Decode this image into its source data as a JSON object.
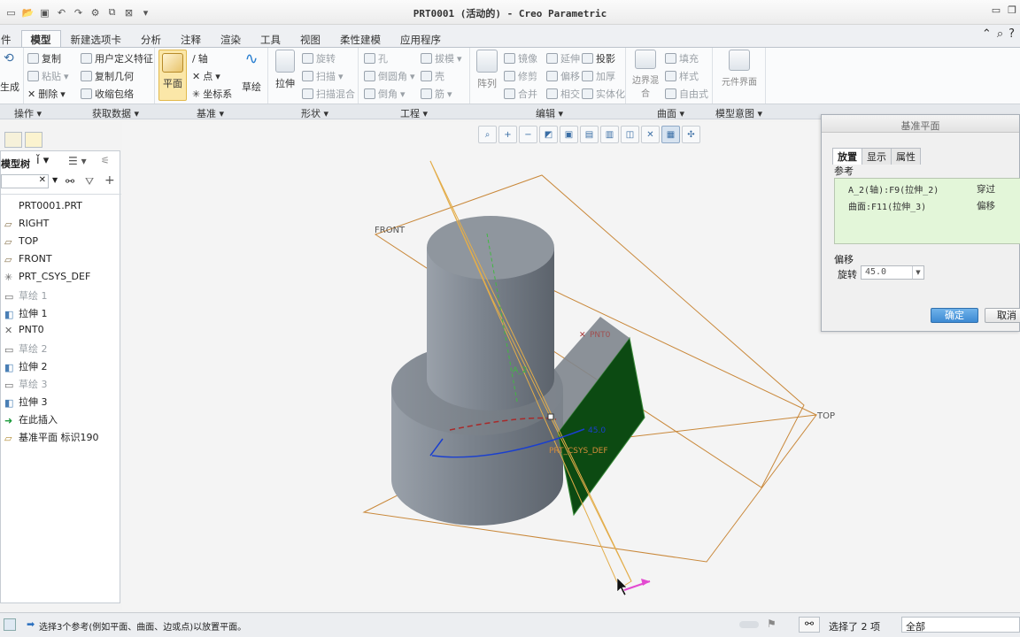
{
  "window": {
    "title": "PRT0001 (活动的) - Creo Parametric"
  },
  "ribbon_tabs": [
    "件",
    "模型",
    "新建选项卡",
    "分析",
    "注释",
    "渲染",
    "工具",
    "视图",
    "柔性建模",
    "应用程序"
  ],
  "ribbon": {
    "ops": {
      "regen": "生成"
    },
    "get_data": {
      "copy": "复制",
      "paste": "粘贴",
      "delete": "删除",
      "udf": "用户定义特征",
      "copy_geom": "复制几何",
      "shrinkwrap": "收缩包络"
    },
    "datum": {
      "plane": "平面",
      "axis": "轴",
      "point": "点",
      "csys": "坐标系",
      "sketch": "草绘"
    },
    "shapes": {
      "extrude": "拉伸",
      "revolve": "旋转",
      "sweep": "扫描",
      "swept_blend": "扫描混合"
    },
    "engineering": {
      "hole": "孔",
      "round": "倒圆角",
      "chamfer": "倒角",
      "draft": "拔模",
      "shell": "壳",
      "rib": "筋"
    },
    "editing": {
      "pattern": "阵列",
      "mirror": "镜像",
      "trim": "修剪",
      "merge": "合并",
      "extend": "延伸",
      "offset": "偏移",
      "intersect": "相交",
      "project": "投影",
      "thicken": "加厚",
      "solidify": "实体化"
    },
    "surfaces": {
      "boundary_blend": "边界混合",
      "fill": "填充",
      "style": "样式",
      "freestyle": "自由式"
    },
    "model_intent": {
      "component_interface": "元件界面"
    }
  },
  "ribbon_groups": [
    "操作",
    "获取数据",
    "基准",
    "形状",
    "工程",
    "编辑",
    "曲面",
    "模型意图"
  ],
  "left_panel": {
    "header": "模型树",
    "search_value": "",
    "items": [
      {
        "label": "PRT0001.PRT",
        "icon": "part-icon",
        "dim": false
      },
      {
        "label": "RIGHT",
        "icon": "plane-icon",
        "dim": false
      },
      {
        "label": "TOP",
        "icon": "plane-icon",
        "dim": false
      },
      {
        "label": "FRONT",
        "icon": "plane-icon",
        "dim": false
      },
      {
        "label": "PRT_CSYS_DEF",
        "icon": "csys-icon",
        "dim": false
      },
      {
        "label": "草绘 1",
        "icon": "sketch-icon",
        "dim": true
      },
      {
        "label": "拉伸 1",
        "icon": "extrude-icon",
        "dim": false
      },
      {
        "label": "PNT0",
        "icon": "point-icon",
        "dim": false
      },
      {
        "label": "草绘 2",
        "icon": "sketch-icon",
        "dim": true
      },
      {
        "label": "拉伸 2",
        "icon": "extrude-icon",
        "dim": false
      },
      {
        "label": "草绘 3",
        "icon": "sketch-icon",
        "dim": true
      },
      {
        "label": "拉伸 3",
        "icon": "extrude-icon",
        "dim": false
      },
      {
        "label": "在此插入",
        "icon": "insert-arrow-icon",
        "dim": false
      },
      {
        "label": "基准平面 标识190",
        "icon": "datum-plane-new-icon",
        "dim": false
      }
    ]
  },
  "viewport": {
    "labels": {
      "front": "FRONT",
      "top": "TOP",
      "pnt": "PNT0",
      "axis": "A_2",
      "csys": "PRT_CSYS_DEF",
      "angle": "45.0"
    },
    "colors": {
      "datum_plane": "#c9883a",
      "selected_face": "#0c4a12",
      "part_body": "#7b838d",
      "preview_arc": "#1a3fcf"
    }
  },
  "dialog": {
    "title": "基准平面",
    "tabs": [
      "放置",
      "显示",
      "属性"
    ],
    "active_tab": "放置",
    "refs_label": "参考",
    "references": [
      {
        "ref": "A_2(轴):F9(拉伸_2)",
        "constraint": "穿过"
      },
      {
        "ref": "曲面:F11(拉伸_3)",
        "constraint": "偏移"
      }
    ],
    "offset_label": "偏移",
    "rotation_label": "旋转",
    "rotation_value": "45.0",
    "ok": "确定",
    "cancel": "取消"
  },
  "status": {
    "message": "选择3个参考(例如平面、曲面、边或点)以放置平面。",
    "selection_count": "选择了 2 项",
    "filter": "全部"
  }
}
